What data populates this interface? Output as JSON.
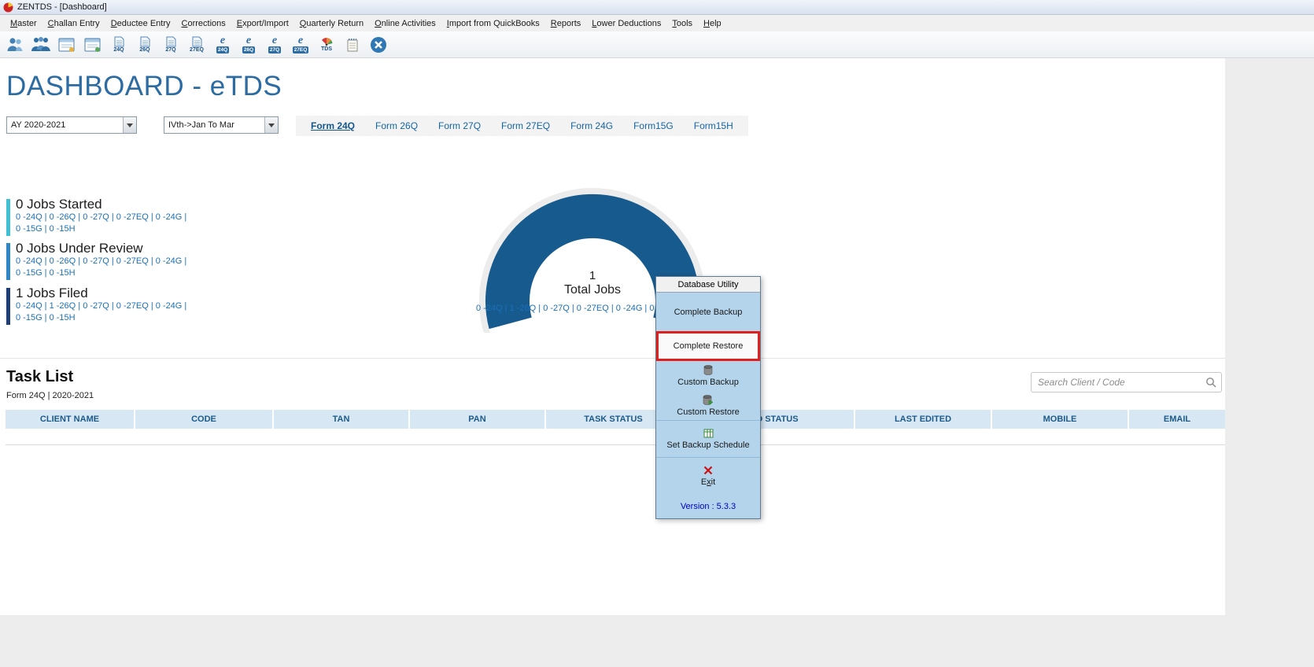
{
  "window": {
    "title": "ZENTDS - [Dashboard]"
  },
  "menu": {
    "items": [
      "Master",
      "Challan Entry",
      "Deductee Entry",
      "Corrections",
      "Export/Import",
      "Quarterly Return",
      "Online Activities",
      "Import from QuickBooks",
      "Reports",
      "Lower Deductions",
      "Tools",
      "Help"
    ]
  },
  "toolbar": {
    "icons": [
      {
        "name": "clients-icon"
      },
      {
        "name": "deductee-group-icon"
      },
      {
        "name": "challan-form-icon"
      },
      {
        "name": "deductee-form-icon"
      },
      {
        "name": "form-24q-icon",
        "badge": "24Q"
      },
      {
        "name": "form-26q-icon",
        "badge": "26Q"
      },
      {
        "name": "form-27q-icon",
        "badge": "27Q"
      },
      {
        "name": "form-27eq-icon",
        "badge": "27EQ"
      },
      {
        "name": "etds-24q-icon",
        "badge": "24Q"
      },
      {
        "name": "etds-26q-icon",
        "badge": "26Q"
      },
      {
        "name": "etds-27q-icon",
        "badge": "27Q"
      },
      {
        "name": "etds-27eq-icon",
        "badge": "27EQ"
      },
      {
        "name": "tds-certificate-icon",
        "badge": "TDS"
      },
      {
        "name": "report-notes-icon"
      },
      {
        "name": "close-icon"
      }
    ]
  },
  "dashboard": {
    "title": "DASHBOARD - eTDS",
    "assessment_year": "AY 2020-2021",
    "quarter": "IVth->Jan To Mar",
    "form_tabs": [
      "Form 24Q",
      "Form 26Q",
      "Form 27Q",
      "Form 27EQ",
      "Form 24G",
      "Form15G",
      "Form15H"
    ],
    "active_tab": "Form 24Q",
    "stats": [
      {
        "title": "0 Jobs Started",
        "line1": "0 -24Q | 0 -26Q | 0 -27Q | 0 -27EQ | 0 -24G |",
        "line2": "0 -15G | 0 -15H",
        "color": "#3fc0d4"
      },
      {
        "title": "0 Jobs Under Review",
        "line1": "0 -24Q | 0 -26Q | 0 -27Q | 0 -27EQ | 0 -24G |",
        "line2": "0 -15G | 0 -15H",
        "color": "#2f86c6"
      },
      {
        "title": "1 Jobs Filed",
        "line1": "0 -24Q | 1 -26Q | 0 -27Q | 0 -27EQ | 0 -24G |",
        "line2": "0 -15G | 0 -15H",
        "color": "#1f3e78"
      }
    ],
    "gauge": {
      "value": "1",
      "label": "Total Jobs",
      "breakdown": "0 -24Q | 1 -26Q | 0 -27Q | 0 -27EQ | 0 -24G | 0 -15G | 0 -15H",
      "arc_color": "#175a8e",
      "track_color": "#ececec"
    }
  },
  "task_list": {
    "title": "Task List",
    "subtitle": "Form 24Q | 2020-2021",
    "search_placeholder": "Search Client / Code",
    "columns": [
      "CLIENT NAME",
      "CODE",
      "TAN",
      "PAN",
      "TASK STATUS",
      "FILED STATUS",
      "LAST EDITED",
      "MOBILE",
      "EMAIL"
    ]
  },
  "popup": {
    "title": "Database Utility",
    "items": [
      {
        "label": "Complete Backup"
      },
      {
        "label": "Complete Restore",
        "highlighted": true,
        "highlight_color": "#e01f1f"
      },
      {
        "label": "Custom Backup",
        "icon": "database-icon"
      },
      {
        "label": "Custom Restore",
        "icon": "database-restore-icon"
      },
      {
        "label": "Set Backup Schedule",
        "icon": "schedule-grid-icon"
      },
      {
        "label": "Exit",
        "icon": "exit-x-icon",
        "accel_index": 1
      }
    ],
    "version": "Version : 5.3.3"
  }
}
